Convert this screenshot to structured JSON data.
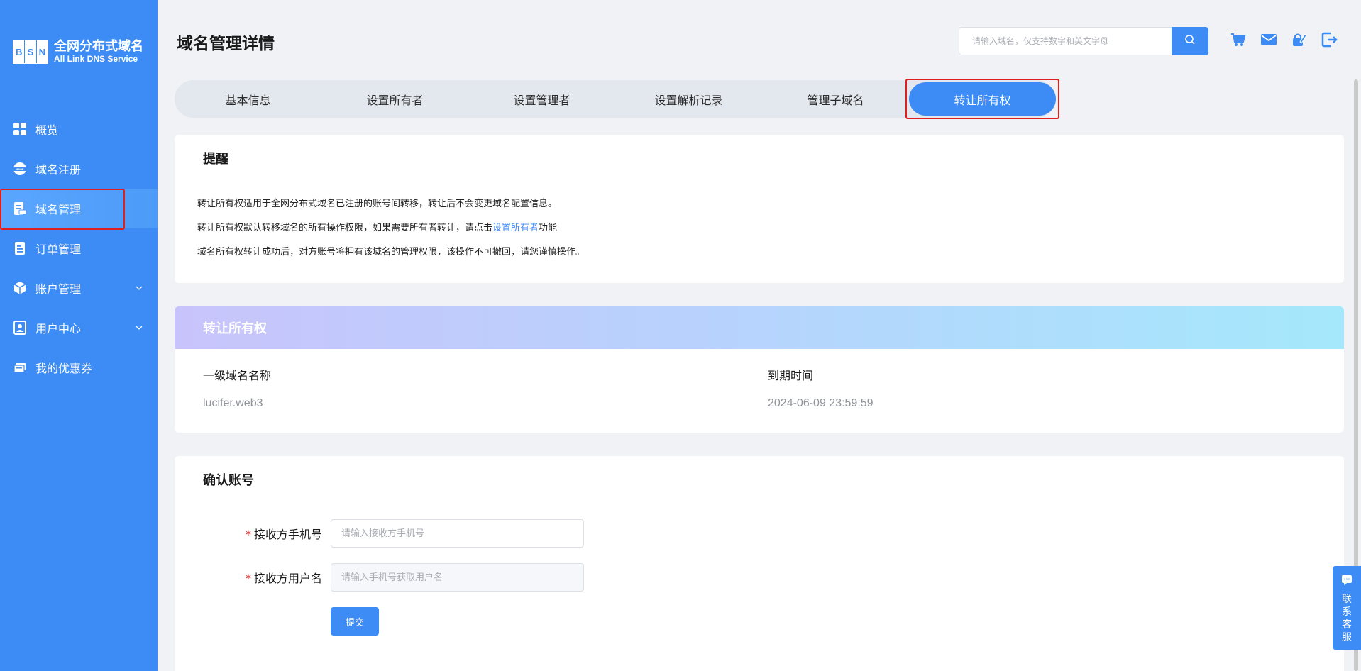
{
  "brand": {
    "logo_letters": [
      "B",
      "S",
      "N"
    ],
    "title": "全网分布式域名",
    "subtitle": "All Link DNS Service",
    "color": "#3d8bf5"
  },
  "sidebar": {
    "items": [
      {
        "label": "概览",
        "icon": "dashboard-grid-icon",
        "expandable": false
      },
      {
        "label": "域名注册",
        "icon": "www-globe-icon",
        "expandable": false
      },
      {
        "label": "域名管理",
        "icon": "domain-manage-icon",
        "expandable": false,
        "active": true
      },
      {
        "label": "订单管理",
        "icon": "order-list-icon",
        "expandable": false
      },
      {
        "label": "账户管理",
        "icon": "account-cube-icon",
        "expandable": true
      },
      {
        "label": "用户中心",
        "icon": "user-card-icon",
        "expandable": true
      },
      {
        "label": "我的优惠券",
        "icon": "coupon-icon",
        "expandable": false
      }
    ]
  },
  "header": {
    "title": "域名管理详情",
    "search_placeholder": "请输入域名，仅支持数字和英文字母",
    "icons": [
      "cart-icon",
      "mail-icon",
      "edit-lock-icon",
      "logout-icon"
    ]
  },
  "tabs": [
    {
      "label": "基本信息"
    },
    {
      "label": "设置所有者"
    },
    {
      "label": "设置管理者"
    },
    {
      "label": "设置解析记录"
    },
    {
      "label": "管理子域名"
    },
    {
      "label": "转让所有权",
      "active": true
    }
  ],
  "notice": {
    "title": "提醒",
    "line1": "转让所有权适用于全网分布式域名已注册的账号间转移，转让后不会变更域名配置信息。",
    "line2_prefix": "转让所有权默认转移域名的所有操作权限，如果需要所有者转让，请点击",
    "line2_link": "设置所有者",
    "line2_suffix": "功能",
    "line3": "域名所有权转让成功后，对方账号将拥有该域名的管理权限，该操作不可撤回，请您谨慎操作。"
  },
  "transfer": {
    "title": "转让所有权",
    "domain_label": "一级域名名称",
    "domain_value": "lucifer.web3",
    "expiry_label": "到期时间",
    "expiry_value": "2024-06-09 23:59:59"
  },
  "confirm": {
    "title": "确认账号",
    "phone_label": "接收方手机号",
    "phone_placeholder": "请输入接收方手机号",
    "username_label": "接收方用户名",
    "username_placeholder": "请输入手机号获取用户名",
    "required_mark": "*",
    "submit_label": "提交"
  },
  "service": {
    "label": "联系客服",
    "icon": "chat-icon"
  }
}
